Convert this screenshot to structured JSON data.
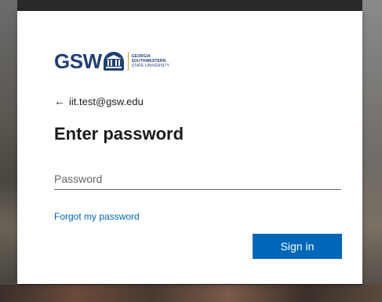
{
  "logo": {
    "acronym": "GSW",
    "line1": "GEORGIA",
    "line2": "SOUTHWESTERN",
    "line3": "STATE UNIVERSITY"
  },
  "back": {
    "icon": "arrow-left-icon",
    "email": "iit.test@gsw.edu"
  },
  "title": "Enter password",
  "password_field": {
    "placeholder": "Password",
    "value": ""
  },
  "forgot_link": "Forgot my password",
  "signin_button": "Sign in",
  "colors": {
    "brand": "#1f3f73",
    "accent_gold": "#c9a227",
    "button": "#0067b8",
    "link": "#0067b8"
  }
}
